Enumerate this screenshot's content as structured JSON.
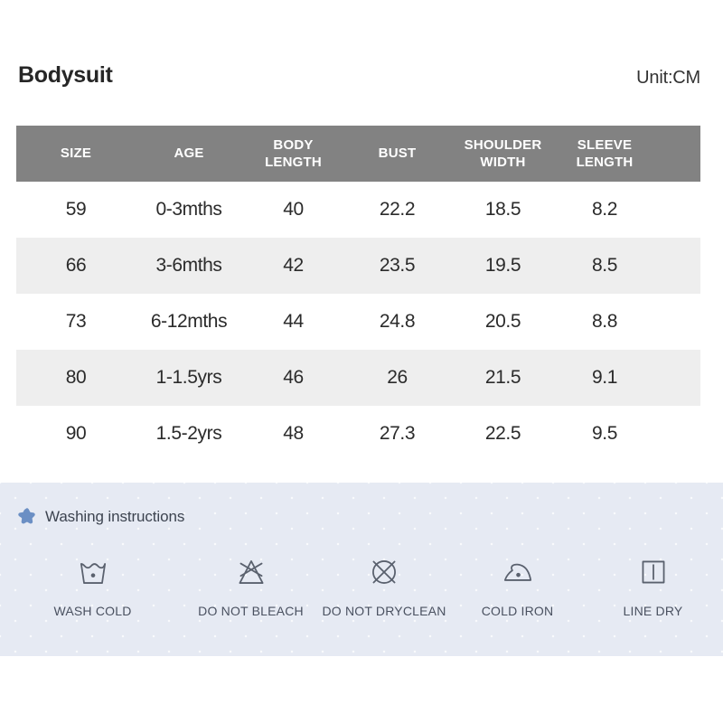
{
  "header": {
    "title": "Bodysuit",
    "unit": "Unit:CM"
  },
  "size_table": {
    "columns": [
      {
        "label": "SIZE",
        "lines": [
          "SIZE"
        ]
      },
      {
        "label": "AGE",
        "lines": [
          "AGE"
        ]
      },
      {
        "label": "BODY LENGTH",
        "lines": [
          "BODY",
          "LENGTH"
        ]
      },
      {
        "label": "BUST",
        "lines": [
          "BUST"
        ]
      },
      {
        "label": "SHOULDER WIDTH",
        "lines": [
          "SHOULDER",
          "WIDTH"
        ]
      },
      {
        "label": "SLEEVE LENGTH",
        "lines": [
          "SLEEVE",
          "LENGTH"
        ]
      }
    ],
    "header_lines": {
      "c0_l0": "SIZE",
      "c1_l0": "AGE",
      "c2_l0": "BODY",
      "c2_l1": "LENGTH",
      "c3_l0": "BUST",
      "c4_l0": "SHOULDER",
      "c4_l1": "WIDTH",
      "c5_l0": "SLEEVE",
      "c5_l1": "LENGTH"
    },
    "rows": [
      {
        "size": "59",
        "age": "0-3mths",
        "body_length": "40",
        "bust": "22.2",
        "shoulder_width": "18.5",
        "sleeve_length": "8.2"
      },
      {
        "size": "66",
        "age": "3-6mths",
        "body_length": "42",
        "bust": "23.5",
        "shoulder_width": "19.5",
        "sleeve_length": "8.5"
      },
      {
        "size": "73",
        "age": "6-12mths",
        "body_length": "44",
        "bust": "24.8",
        "shoulder_width": "20.5",
        "sleeve_length": "8.8"
      },
      {
        "size": "80",
        "age": "1-1.5yrs",
        "body_length": "46",
        "bust": "26",
        "shoulder_width": "21.5",
        "sleeve_length": "9.1"
      },
      {
        "size": "90",
        "age": "1.5-2yrs",
        "body_length": "48",
        "bust": "27.3",
        "shoulder_width": "22.5",
        "sleeve_length": "9.5"
      }
    ]
  },
  "washing": {
    "heading": "Washing instructions",
    "star_icon": "star-icon",
    "items": [
      {
        "icon": "wash-tub-one-dot-icon",
        "label": "WASH COLD"
      },
      {
        "icon": "crossed-triangle-icon",
        "label": "DO NOT BLEACH"
      },
      {
        "icon": "crossed-circle-icon",
        "label": "DO NOT DRYCLEAN"
      },
      {
        "icon": "iron-one-dot-icon",
        "label": "COLD IRON"
      },
      {
        "icon": "square-vertical-line-icon",
        "label": "LINE DRY"
      }
    ]
  },
  "colors": {
    "table_header_bg": "#828282",
    "table_header_text": "#ffffff",
    "row_alt_bg": "#eeeeee",
    "body_text": "#2b2b2b",
    "panel_bg": "#e6eaf3",
    "star_blue": "#6b8fc4",
    "care_stroke": "#5a616e"
  }
}
